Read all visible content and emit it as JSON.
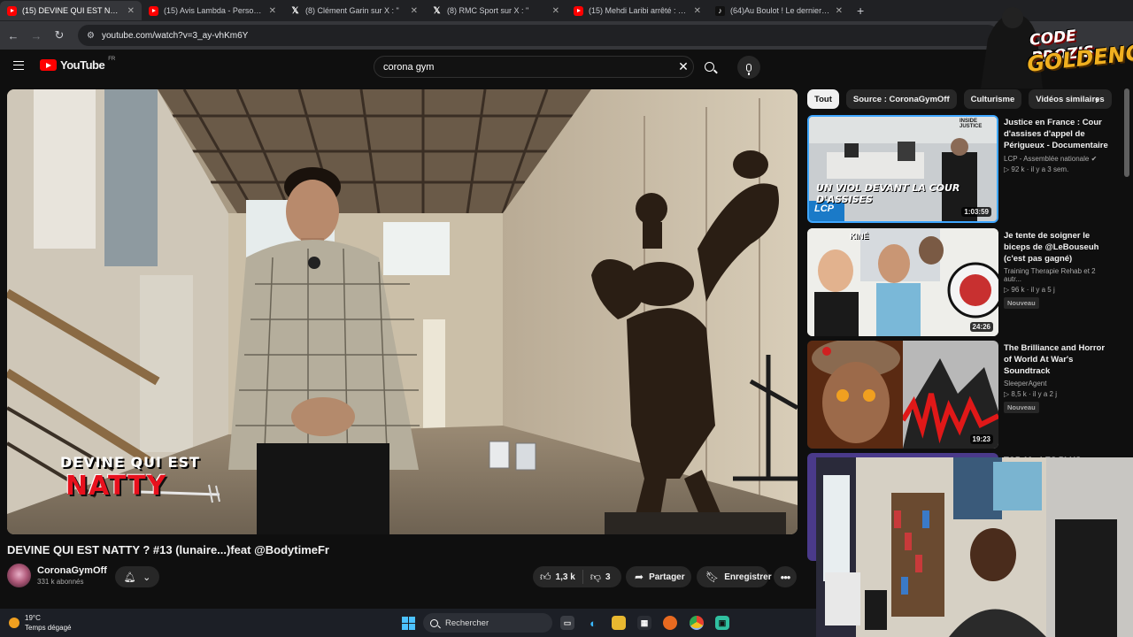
{
  "browser": {
    "tabs": [
      {
        "label": "(15) DEVINE QUI EST NATTY ? #",
        "icon": "youtube-icon",
        "active": true
      },
      {
        "label": "(15) Avis Lambda - Persona 5 R",
        "icon": "youtube-icon",
        "active": false
      },
      {
        "label": "(8) Clément Garin sur X : \"",
        "icon": "x-icon",
        "active": false
      },
      {
        "label": "(8) RMC Sport sur X : \"",
        "icon": "x-icon",
        "active": false
      },
      {
        "label": "(15) Mehdi Laribi arrêté : \"La D",
        "icon": "youtube-icon",
        "active": false
      },
      {
        "label": "(64)Au Boulot ! Le dernier film",
        "icon": "tiktok-icon",
        "active": false
      }
    ],
    "url": "youtube.com/watch?v=3_ay-vhKm6Y"
  },
  "youtube": {
    "logo_text": "YouTube",
    "country_code": "FR",
    "search_value": "corona gym"
  },
  "video": {
    "overlay_line1": "DEVINE QUI EST",
    "overlay_line2": "NATTY",
    "title": "DEVINE QUI EST NATTY ? #13 (lunaire...)feat @BodytimeFr",
    "channel": "CoronaGymOff",
    "subscribers": "331 k abonnés",
    "likes": "1,3 k",
    "dislikes": "3",
    "share_label": "Partager",
    "save_label": "Enregistrer"
  },
  "chips": [
    "Tout",
    "Source : CoronaGymOff",
    "Culturisme",
    "Vidéos similaires"
  ],
  "recommendations": [
    {
      "title": "Justice en France : Cour d'assises d'appel de Périgueux - Documentaire ...",
      "channel": "LCP - Assemblée nationale",
      "views": "92 k",
      "age": "il y a 3 sem.",
      "duration": "1:03:59",
      "badge": "",
      "thumb_caption": "UN VIOL DEVANT LA COUR D'ASSISES",
      "thumb_logo": "LCP",
      "thumb_label": "INSIDE JUSTICE"
    },
    {
      "title": "Je tente de soigner le biceps de @LeBouseuh (c'est pas gagné)",
      "channel": "Training Therapie Rehab et 2 autr...",
      "views": "96 k",
      "age": "il y a 5 j",
      "duration": "24:26",
      "badge": "Nouveau",
      "thumb_label": "KINÉ"
    },
    {
      "title": "The Brilliance and Horror of World At War's Soundtrack",
      "channel": "SleeperAgent",
      "views": "8,5 k",
      "age": "il y a 2 j",
      "duration": "19:23",
      "badge": "Nouveau"
    },
    {
      "title": "TOP 10 : LES PLUS",
      "channel": "",
      "views": "",
      "age": "",
      "duration": "",
      "badge": ""
    }
  ],
  "stream_overlay": {
    "line1": "CODE PROZIS",
    "line2": "GOLDENG"
  },
  "taskbar": {
    "temperature": "19°C",
    "weather": "Temps dégagé",
    "search_placeholder": "Rechercher"
  },
  "colors": {
    "yt_red": "#ff0000",
    "background": "#0f0f0f",
    "chip_bg": "#272727",
    "overlay_red": "#e8111d",
    "overlay_gold": "#f0b020"
  }
}
